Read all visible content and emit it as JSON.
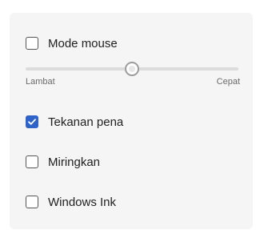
{
  "options": {
    "mouse_mode": {
      "label": "Mode mouse",
      "checked": false
    },
    "pen_pressure": {
      "label": "Tekanan pena",
      "checked": true
    },
    "tilt": {
      "label": "Miringkan",
      "checked": false
    },
    "windows_ink": {
      "label": "Windows Ink",
      "checked": false
    }
  },
  "speed_slider": {
    "min_label": "Lambat",
    "max_label": "Cepat",
    "value_fraction": 0.5
  },
  "colors": {
    "accent": "#2f63c7",
    "panel_background": "#f5f5f5"
  },
  "icons": {
    "checked": "checkmark-icon"
  }
}
